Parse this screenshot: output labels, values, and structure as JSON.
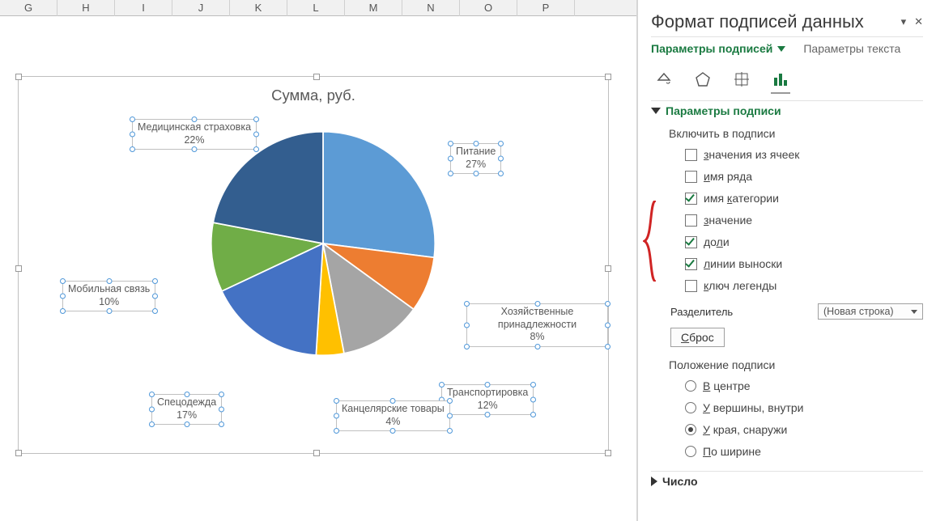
{
  "columns": [
    "G",
    "H",
    "I",
    "J",
    "K",
    "L",
    "M",
    "N",
    "O",
    "P"
  ],
  "chart_data": {
    "type": "pie",
    "title": "Сумма, руб.",
    "categories": [
      "Питание",
      "Хозяйственные принадлежности",
      "Транспортировка",
      "Канцелярские товары",
      "Спецодежда",
      "Мобильная связь",
      "Медицинская страховка"
    ],
    "values": [
      27,
      8,
      12,
      4,
      17,
      10,
      22
    ],
    "colors": [
      "#5c9bd5",
      "#ed7d31",
      "#a5a5a5",
      "#ffc000",
      "#4472c4",
      "#70ad47",
      "#335e8f"
    ],
    "label_percent_format": "%d%%"
  },
  "labels": [
    {
      "name": "Питание",
      "pct": "27%"
    },
    {
      "name": "Хозяйственные принадлежности",
      "pct": "8%"
    },
    {
      "name": "Транспортировка",
      "pct": "12%"
    },
    {
      "name": "Канцелярские товары",
      "pct": "4%"
    },
    {
      "name": "Спецодежда",
      "pct": "17%"
    },
    {
      "name": "Мобильная связь",
      "pct": "10%"
    },
    {
      "name": "Медицинская страховка",
      "pct": "22%"
    }
  ],
  "pane": {
    "title": "Формат подписей данных",
    "tab_options": "Параметры подписей",
    "tab_text": "Параметры текста",
    "section_params": "Параметры подписи",
    "include_header": "Включить в подписи",
    "checks": {
      "from_cells": "значения из ячеек",
      "series_name": "имя ряда",
      "category_name": "имя категории",
      "value": "значение",
      "percent": "доли",
      "leader_lines": "линии выноски",
      "legend_key": "ключ легенды"
    },
    "separator_label": "Разделитель",
    "separator_value": "(Новая строка)",
    "reset": "Сброс",
    "position_header": "Положение подписи",
    "positions": {
      "center": "В центре",
      "inside_end": "У вершины, внутри",
      "outside_end": "У края, снаружи",
      "best_fit": "По ширине"
    },
    "section_number": "Число"
  }
}
